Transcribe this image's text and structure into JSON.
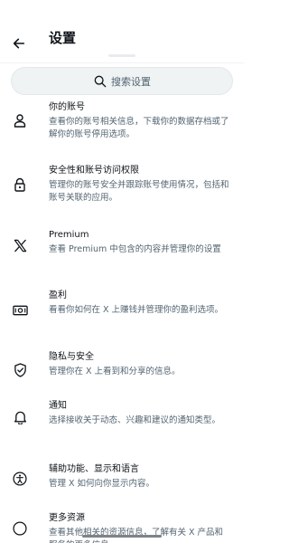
{
  "header": {
    "title": "设置"
  },
  "search": {
    "placeholder": "搜索设置"
  },
  "items": [
    {
      "label": "你的账号",
      "desc": "查看你的账号相关信息，下载你的数据存档或了解你的账号停用选项。"
    },
    {
      "label": "安全性和账号访问权限",
      "desc": "管理你的账号安全并跟踪账号使用情况，包括和账号关联的应用。"
    },
    {
      "label": "Premium",
      "desc": "查看 Premium 中包含的内容并管理你的设置"
    },
    {
      "label": "盈利",
      "desc": "看看你如何在 X 上赚钱并管理你的盈利选项。"
    },
    {
      "label": "隐私与安全",
      "desc": "管理你在 X 上看到和分享的信息。"
    },
    {
      "label": "通知",
      "desc": "选择接收关于动态、兴趣和建议的通知类型。"
    },
    {
      "label": "辅助功能、显示和语言",
      "desc": "管理 X 如何向你显示内容。"
    },
    {
      "label": "更多资源",
      "desc": "查看其他相关的资源信息，了解有关 X 产品和服务的更多信息。"
    }
  ]
}
